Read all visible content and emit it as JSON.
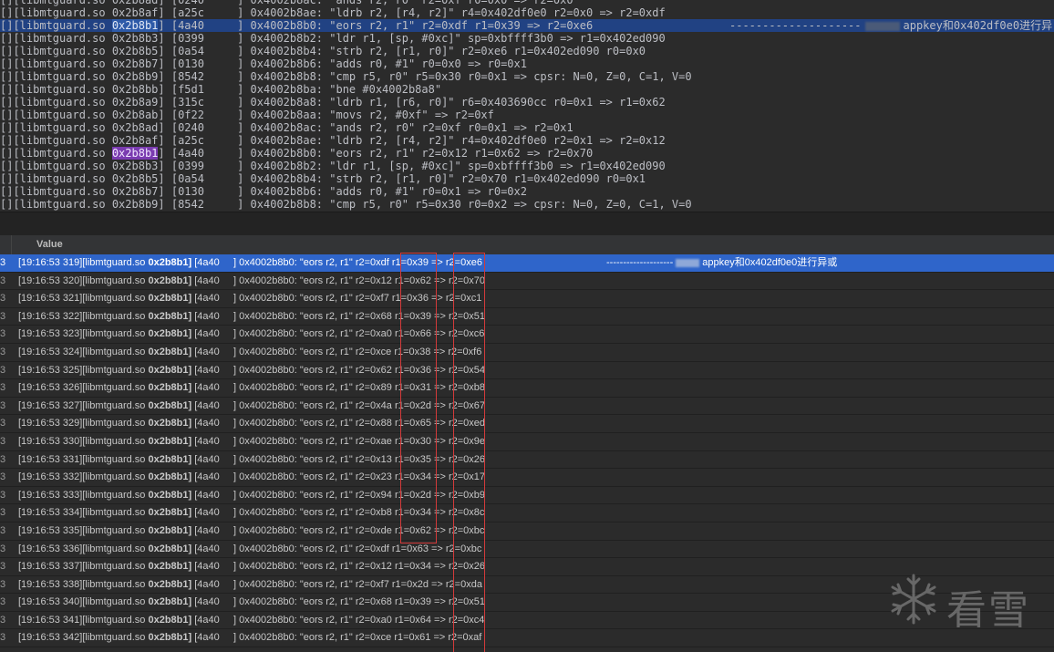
{
  "trace_lines": [
    {
      "text": "[][libmtguard.so 0x2b8ad] [0240     ] 0x4002b8ac: \"ands r2, r0\" r2=0xf r0=0x0 => r2=0x0",
      "pre": "[][libmtguard.so ",
      "so": "0x2b8ad",
      "post": "] [0240     ] 0x4002b8ac: \"ands r2, r0\" r2=0xf r0=0x0 => r2=0x0"
    },
    {
      "pre": "[][libmtguard.so ",
      "so": "0x2b8af",
      "post": "] [a25c     ] 0x4002b8ae: \"ldrb r2, [r4, r2]\" r4=0x402df0e0 r2=0x0 => r2=0xdf"
    },
    {
      "pre": "[][libmtguard.so ",
      "so": "0x2b8b1",
      "post": "] [4a40     ] 0x4002b8b0: \"eors r2, r1\" r2=0xdf r1=0x39 => r2=0xe6",
      "sel": true,
      "hl": "hl1",
      "note": "--------------------",
      "note2": "appkey和0x402df0e0进行异"
    },
    {
      "pre": "[][libmtguard.so ",
      "so": "0x2b8b3",
      "post": "] [0399     ] 0x4002b8b2: \"ldr r1, [sp, #0xc]\" sp=0xbffff3b0 => r1=0x402ed090"
    },
    {
      "pre": "[][libmtguard.so ",
      "so": "0x2b8b5",
      "post": "] [0a54     ] 0x4002b8b4: \"strb r2, [r1, r0]\" r2=0xe6 r1=0x402ed090 r0=0x0"
    },
    {
      "pre": "[][libmtguard.so ",
      "so": "0x2b8b7",
      "post": "] [0130     ] 0x4002b8b6: \"adds r0, #1\" r0=0x0 => r0=0x1"
    },
    {
      "pre": "[][libmtguard.so ",
      "so": "0x2b8b9",
      "post": "] [8542     ] 0x4002b8b8: \"cmp r5, r0\" r5=0x30 r0=0x1 => cpsr: N=0, Z=0, C=1, V=0"
    },
    {
      "pre": "[][libmtguard.so ",
      "so": "0x2b8bb",
      "post": "] [f5d1     ] 0x4002b8ba: \"bne #0x4002b8a8\""
    },
    {
      "pre": "[][libmtguard.so ",
      "so": "0x2b8a9",
      "post": "] [315c     ] 0x4002b8a8: \"ldrb r1, [r6, r0]\" r6=0x403690cc r0=0x1 => r1=0x62"
    },
    {
      "pre": "[][libmtguard.so ",
      "so": "0x2b8ab",
      "post": "] [0f22     ] 0x4002b8aa: \"movs r2, #0xf\" => r2=0xf"
    },
    {
      "pre": "[][libmtguard.so ",
      "so": "0x2b8ad",
      "post": "] [0240     ] 0x4002b8ac: \"ands r2, r0\" r2=0xf r0=0x1 => r2=0x1"
    },
    {
      "pre": "[][libmtguard.so ",
      "so": "0x2b8af",
      "post": "] [a25c     ] 0x4002b8ae: \"ldrb r2, [r4, r2]\" r4=0x402df0e0 r2=0x1 => r2=0x12"
    },
    {
      "pre": "[][libmtguard.so ",
      "so": "0x2b8b1",
      "post": "] [4a40     ] 0x4002b8b0: \"eors r2, r1\" r2=0x12 r1=0x62 => r2=0x70",
      "hl": "hl2"
    },
    {
      "pre": "[][libmtguard.so ",
      "so": "0x2b8b3",
      "post": "] [0399     ] 0x4002b8b2: \"ldr r1, [sp, #0xc]\" sp=0xbffff3b0 => r1=0x402ed090"
    },
    {
      "pre": "[][libmtguard.so ",
      "so": "0x2b8b5",
      "post": "] [0a54     ] 0x4002b8b4: \"strb r2, [r1, r0]\" r2=0x70 r1=0x402ed090 r0=0x1"
    },
    {
      "pre": "[][libmtguard.so ",
      "so": "0x2b8b7",
      "post": "] [0130     ] 0x4002b8b6: \"adds r0, #1\" r0=0x1 => r0=0x2"
    },
    {
      "pre": "[][libmtguard.so ",
      "so": "0x2b8b9",
      "post": "] [8542     ] 0x4002b8b8: \"cmp r5, r0\" r5=0x30 r0=0x2 => cpsr: N=0, Z=0, C=1, V=0"
    }
  ],
  "table": {
    "header": "Value",
    "row_index": "3",
    "rows": [
      {
        "ts": "[19:16:53 319][libmtguard.so ",
        "addr": "0x2b8b1]",
        "rest": " [4a40     ] 0x4002b8b0: \"eors r2, r1\" r2=0xdf r1=0x39 => r2=0xe6",
        "sel": true,
        "note": "--------------------",
        "note2": "appkey和0x402df0e0进行异或"
      },
      {
        "ts": "[19:16:53 320][libmtguard.so ",
        "addr": "0x2b8b1]",
        "rest": " [4a40     ] 0x4002b8b0: \"eors r2, r1\" r2=0x12 r1=0x62 => r2=0x70"
      },
      {
        "ts": "[19:16:53 321][libmtguard.so ",
        "addr": "0x2b8b1]",
        "rest": " [4a40     ] 0x4002b8b0: \"eors r2, r1\" r2=0xf7 r1=0x36 => r2=0xc1"
      },
      {
        "ts": "[19:16:53 322][libmtguard.so ",
        "addr": "0x2b8b1]",
        "rest": " [4a40     ] 0x4002b8b0: \"eors r2, r1\" r2=0x68 r1=0x39 => r2=0x51"
      },
      {
        "ts": "[19:16:53 323][libmtguard.so ",
        "addr": "0x2b8b1]",
        "rest": " [4a40     ] 0x4002b8b0: \"eors r2, r1\" r2=0xa0 r1=0x66 => r2=0xc6"
      },
      {
        "ts": "[19:16:53 324][libmtguard.so ",
        "addr": "0x2b8b1]",
        "rest": " [4a40     ] 0x4002b8b0: \"eors r2, r1\" r2=0xce r1=0x38 => r2=0xf6"
      },
      {
        "ts": "[19:16:53 325][libmtguard.so ",
        "addr": "0x2b8b1]",
        "rest": " [4a40     ] 0x4002b8b0: \"eors r2, r1\" r2=0x62 r1=0x36 => r2=0x54"
      },
      {
        "ts": "[19:16:53 326][libmtguard.so ",
        "addr": "0x2b8b1]",
        "rest": " [4a40     ] 0x4002b8b0: \"eors r2, r1\" r2=0x89 r1=0x31 => r2=0xb8"
      },
      {
        "ts": "[19:16:53 327][libmtguard.so ",
        "addr": "0x2b8b1]",
        "rest": " [4a40     ] 0x4002b8b0: \"eors r2, r1\" r2=0x4a r1=0x2d => r2=0x67"
      },
      {
        "ts": "[19:16:53 329][libmtguard.so ",
        "addr": "0x2b8b1]",
        "rest": " [4a40     ] 0x4002b8b0: \"eors r2, r1\" r2=0x88 r1=0x65 => r2=0xed"
      },
      {
        "ts": "[19:16:53 330][libmtguard.so ",
        "addr": "0x2b8b1]",
        "rest": " [4a40     ] 0x4002b8b0: \"eors r2, r1\" r2=0xae r1=0x30 => r2=0x9e"
      },
      {
        "ts": "[19:16:53 331][libmtguard.so ",
        "addr": "0x2b8b1]",
        "rest": " [4a40     ] 0x4002b8b0: \"eors r2, r1\" r2=0x13 r1=0x35 => r2=0x26"
      },
      {
        "ts": "[19:16:53 332][libmtguard.so ",
        "addr": "0x2b8b1]",
        "rest": " [4a40     ] 0x4002b8b0: \"eors r2, r1\" r2=0x23 r1=0x34 => r2=0x17"
      },
      {
        "ts": "[19:16:53 333][libmtguard.so ",
        "addr": "0x2b8b1]",
        "rest": " [4a40     ] 0x4002b8b0: \"eors r2, r1\" r2=0x94 r1=0x2d => r2=0xb9"
      },
      {
        "ts": "[19:16:53 334][libmtguard.so ",
        "addr": "0x2b8b1]",
        "rest": " [4a40     ] 0x4002b8b0: \"eors r2, r1\" r2=0xb8 r1=0x34 => r2=0x8c"
      },
      {
        "ts": "[19:16:53 335][libmtguard.so ",
        "addr": "0x2b8b1]",
        "rest": " [4a40     ] 0x4002b8b0: \"eors r2, r1\" r2=0xde r1=0x62 => r2=0xbc"
      },
      {
        "ts": "[19:16:53 336][libmtguard.so ",
        "addr": "0x2b8b1]",
        "rest": " [4a40     ] 0x4002b8b0: \"eors r2, r1\" r2=0xdf r1=0x63 => r2=0xbc"
      },
      {
        "ts": "[19:16:53 337][libmtguard.so ",
        "addr": "0x2b8b1]",
        "rest": " [4a40     ] 0x4002b8b0: \"eors r2, r1\" r2=0x12 r1=0x34 => r2=0x26"
      },
      {
        "ts": "[19:16:53 338][libmtguard.so ",
        "addr": "0x2b8b1]",
        "rest": " [4a40     ] 0x4002b8b0: \"eors r2, r1\" r2=0xf7 r1=0x2d => r2=0xda"
      },
      {
        "ts": "[19:16:53 340][libmtguard.so ",
        "addr": "0x2b8b1]",
        "rest": " [4a40     ] 0x4002b8b0: \"eors r2, r1\" r2=0x68 r1=0x39 => r2=0x51"
      },
      {
        "ts": "[19:16:53 341][libmtguard.so ",
        "addr": "0x2b8b1]",
        "rest": " [4a40     ] 0x4002b8b0: \"eors r2, r1\" r2=0xa0 r1=0x64 => r2=0xc4"
      },
      {
        "ts": "[19:16:53 342][libmtguard.so ",
        "addr": "0x2b8b1]",
        "rest": " [4a40     ] 0x4002b8b0: \"eors r2, r1\" r2=0xce r1=0x61 => r2=0xaf"
      }
    ]
  },
  "watermark": {
    "text": "看雪",
    "icon": "snowflake-icon"
  },
  "colors": {
    "selection": "#2f65ca",
    "highlight_box": "#d33a3a",
    "so_highlight_blue": "#2d5aa8",
    "so_highlight_purple": "#7a3bb0"
  }
}
